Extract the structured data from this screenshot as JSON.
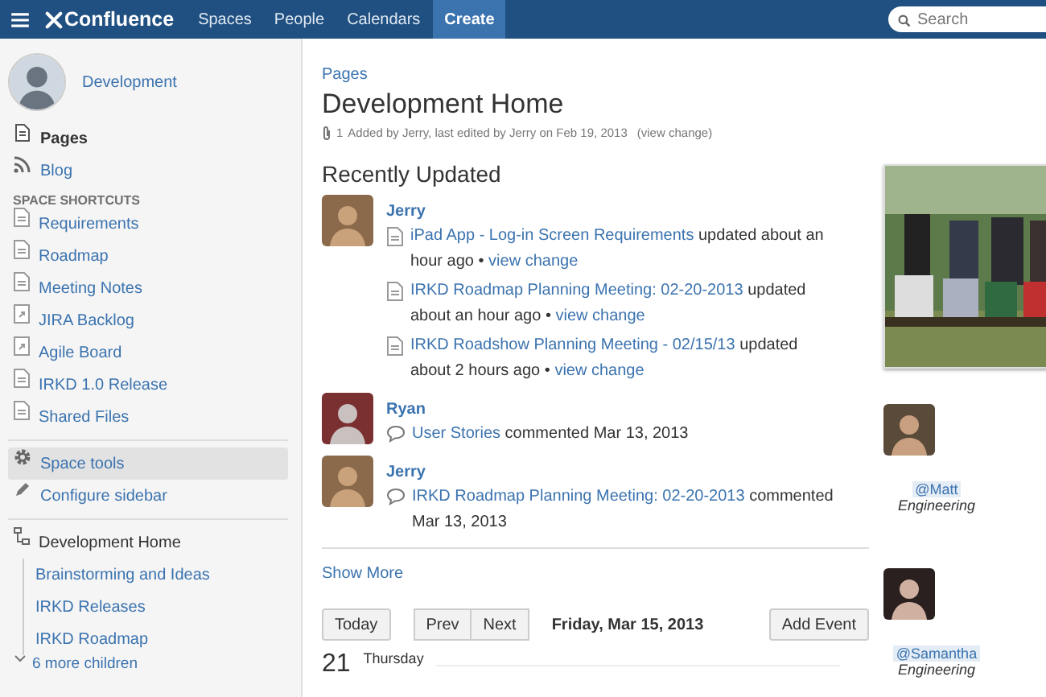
{
  "header": {
    "logo": "Confluence",
    "nav": [
      {
        "label": "Spaces",
        "kind": "link"
      },
      {
        "label": "People",
        "kind": "link"
      },
      {
        "label": "Calendars",
        "kind": "link"
      },
      {
        "label": "Create",
        "kind": "button"
      }
    ],
    "search": {
      "placeholder": "Search"
    }
  },
  "sidebar": {
    "space": "Development",
    "nav": [
      {
        "label": "Pages",
        "selected": true
      },
      {
        "label": "Blog",
        "selected": false
      }
    ],
    "shortcuts_heading": "SPACE SHORTCUTS",
    "shortcuts": [
      {
        "label": "Requirements",
        "kind": "page"
      },
      {
        "label": "Roadmap",
        "kind": "page"
      },
      {
        "label": "Meeting Notes",
        "kind": "page"
      },
      {
        "label": "JIRA Backlog",
        "kind": "link"
      },
      {
        "label": "Agile Board",
        "kind": "link"
      },
      {
        "label": "IRKD 1.0 Release",
        "kind": "page"
      },
      {
        "label": "Shared Files",
        "kind": "page"
      }
    ],
    "tools": [
      {
        "label": "Space tools",
        "highlighted": true
      },
      {
        "label": "Configure sidebar",
        "highlighted": false
      }
    ],
    "tree": {
      "label": "Development Home",
      "children": [
        {
          "label": "Brainstorming and Ideas"
        },
        {
          "label": "IRKD Releases"
        },
        {
          "label": "IRKD Roadmap"
        }
      ],
      "more": "6 more children"
    }
  },
  "page": {
    "breadcrumb": "Pages",
    "title": "Development Home",
    "attachments": "1",
    "byline": "Added by Jerry, last edited by Jerry on Feb 19, 2013",
    "byline_link": "(view change)",
    "recent": {
      "heading": "Recently Updated",
      "groups": [
        {
          "user": "Jerry",
          "items": [
            {
              "kind": "page",
              "title": "iPad App - Log-in Screen Requirements",
              "action": "updated about an hour ago •",
              "link": "view change"
            },
            {
              "kind": "page",
              "title": "IRKD Roadmap Planning Meeting: 02-20-2013",
              "action": "updated about an hour ago •",
              "link": "view change"
            },
            {
              "kind": "page",
              "title": "IRKD Roadshow Planning Meeting - 02/15/13",
              "action": "updated about 2 hours ago •",
              "link": "view change"
            }
          ]
        },
        {
          "user": "Ryan",
          "items": [
            {
              "kind": "comment",
              "title": "User Stories",
              "action": "commented Mar 13, 2013"
            }
          ]
        },
        {
          "user": "Jerry",
          "items": [
            {
              "kind": "comment",
              "title": "IRKD Roadmap Planning Meeting: 02-20-2013",
              "action": "commented Mar 13, 2013"
            }
          ]
        }
      ],
      "more": "Show More"
    },
    "calendar": {
      "today": "Today",
      "prev": "Prev",
      "next": "Next",
      "date": "Friday, Mar 15, 2013",
      "add": "Add Event",
      "day_number": "21",
      "day_name": "Thursday"
    }
  },
  "people": [
    {
      "mention": "@Matt",
      "team": "Engineering"
    },
    {
      "mention": "@Samantha",
      "team": "Engineering"
    }
  ]
}
